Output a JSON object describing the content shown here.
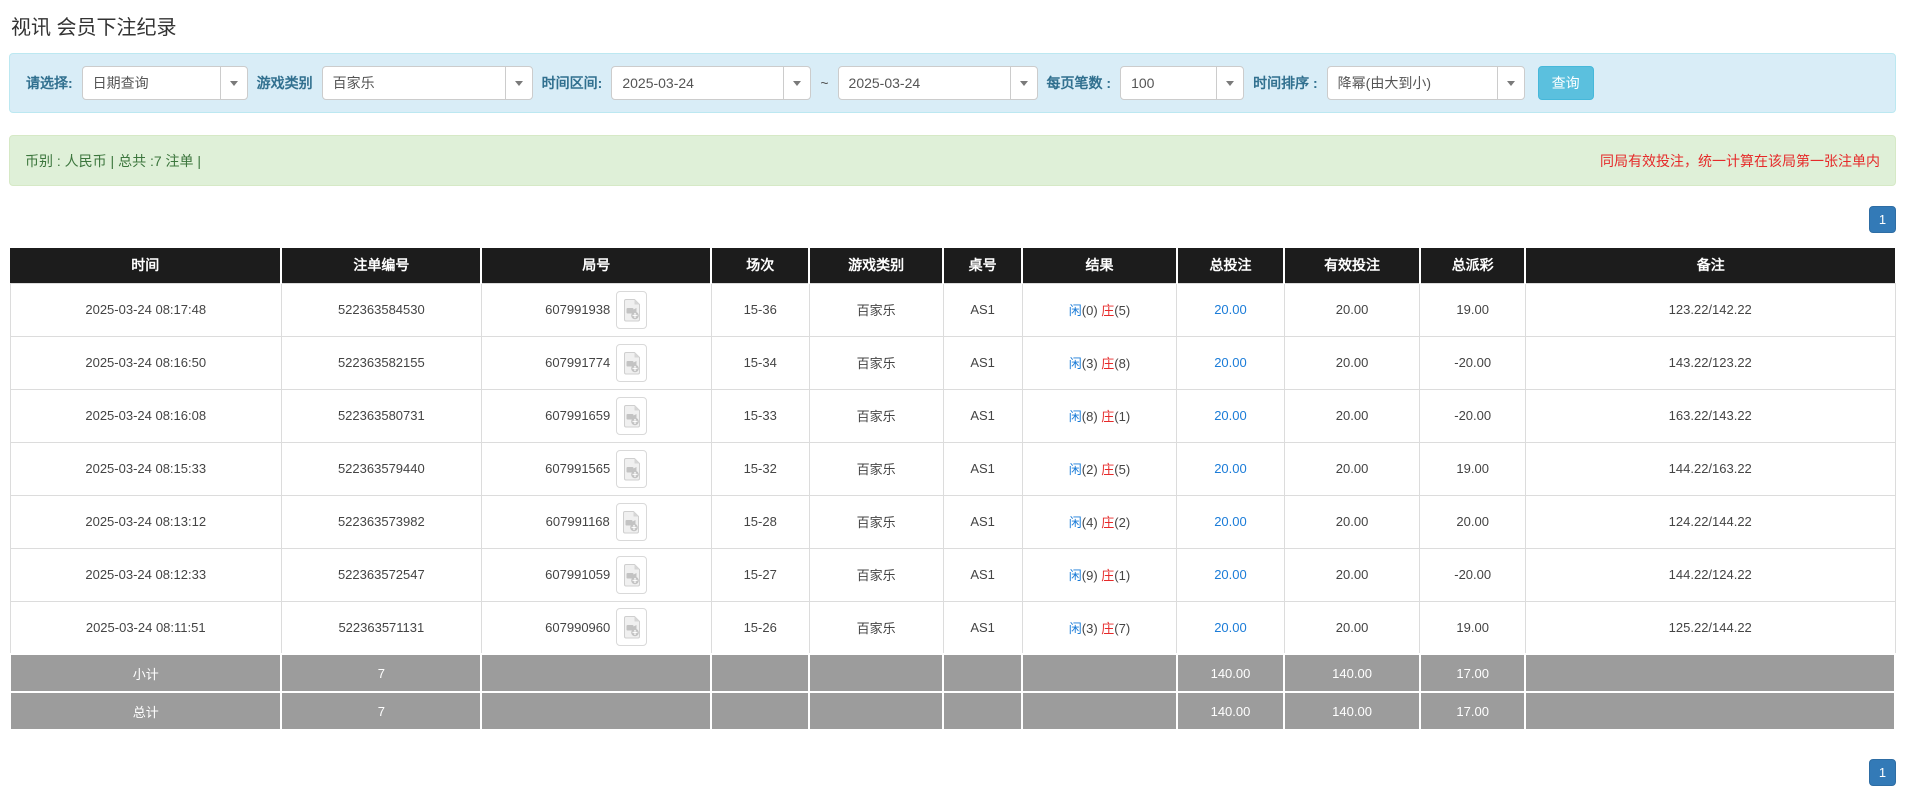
{
  "page_title": "视讯 会员下注纪录",
  "filter_bar": {
    "select_label": "请选择:",
    "select_value": "日期查询",
    "game_type_label": "游戏类别",
    "game_type_value": "百家乐",
    "date_range_label": "时间区间:",
    "date_from": "2025-03-24",
    "date_separator": "~",
    "date_to": "2025-03-24",
    "per_page_label": "每页笔数 :",
    "per_page_value": "100",
    "sort_label": "时间排序 :",
    "sort_value": "降幂(由大到小)",
    "query_button": "查询"
  },
  "summary_bar": {
    "left_text": "币别 : 人民币 | 总共 :7 注单 |",
    "right_notice": "同局有效投注，统一计算在该局第一张注单内"
  },
  "pagination": {
    "current_page": "1"
  },
  "table": {
    "headers": [
      "时间",
      "注单编号",
      "局号",
      "场次",
      "游戏类别",
      "桌号",
      "结果",
      "总投注",
      "有效投注",
      "总派彩",
      "备注"
    ],
    "result_labels": {
      "player": "闲",
      "banker": "庄"
    },
    "round_icon": "video-replay-icon",
    "rows": [
      {
        "time": "2025-03-24 08:17:48",
        "bet_id": "522363584530",
        "round_id": "607991938",
        "session": "15-36",
        "game": "百家乐",
        "table": "AS1",
        "result_player": "0",
        "result_banker": "5",
        "total_bet": "20.00",
        "valid_bet": "20.00",
        "payout": "19.00",
        "remark": "123.22/142.22"
      },
      {
        "time": "2025-03-24 08:16:50",
        "bet_id": "522363582155",
        "round_id": "607991774",
        "session": "15-34",
        "game": "百家乐",
        "table": "AS1",
        "result_player": "3",
        "result_banker": "8",
        "total_bet": "20.00",
        "valid_bet": "20.00",
        "payout": "-20.00",
        "remark": "143.22/123.22"
      },
      {
        "time": "2025-03-24 08:16:08",
        "bet_id": "522363580731",
        "round_id": "607991659",
        "session": "15-33",
        "game": "百家乐",
        "table": "AS1",
        "result_player": "8",
        "result_banker": "1",
        "total_bet": "20.00",
        "valid_bet": "20.00",
        "payout": "-20.00",
        "remark": "163.22/143.22"
      },
      {
        "time": "2025-03-24 08:15:33",
        "bet_id": "522363579440",
        "round_id": "607991565",
        "session": "15-32",
        "game": "百家乐",
        "table": "AS1",
        "result_player": "2",
        "result_banker": "5",
        "total_bet": "20.00",
        "valid_bet": "20.00",
        "payout": "19.00",
        "remark": "144.22/163.22"
      },
      {
        "time": "2025-03-24 08:13:12",
        "bet_id": "522363573982",
        "round_id": "607991168",
        "session": "15-28",
        "game": "百家乐",
        "table": "AS1",
        "result_player": "4",
        "result_banker": "2",
        "total_bet": "20.00",
        "valid_bet": "20.00",
        "payout": "20.00",
        "remark": "124.22/144.22"
      },
      {
        "time": "2025-03-24 08:12:33",
        "bet_id": "522363572547",
        "round_id": "607991059",
        "session": "15-27",
        "game": "百家乐",
        "table": "AS1",
        "result_player": "9",
        "result_banker": "1",
        "total_bet": "20.00",
        "valid_bet": "20.00",
        "payout": "-20.00",
        "remark": "144.22/124.22"
      },
      {
        "time": "2025-03-24 08:11:51",
        "bet_id": "522363571131",
        "round_id": "607990960",
        "session": "15-26",
        "game": "百家乐",
        "table": "AS1",
        "result_player": "3",
        "result_banker": "7",
        "total_bet": "20.00",
        "valid_bet": "20.00",
        "payout": "19.00",
        "remark": "125.22/144.22"
      }
    ],
    "footer_rows": [
      {
        "label": "小计",
        "count": "7",
        "total_bet": "140.00",
        "valid_bet": "140.00",
        "payout": "17.00"
      },
      {
        "label": "总计",
        "count": "7",
        "total_bet": "140.00",
        "valid_bet": "140.00",
        "payout": "17.00"
      }
    ]
  },
  "colors": {
    "accent_blue": "#1b7cd8",
    "loss_red": "#e62a2a",
    "header_bg": "#1c1c1c",
    "footer_bg": "#9c9c9c",
    "filter_bar_bg": "#d9edf7",
    "summary_bar_bg": "#dff0d8",
    "pager_active_bg": "#337ab7",
    "query_button_bg": "#5bc0de"
  }
}
